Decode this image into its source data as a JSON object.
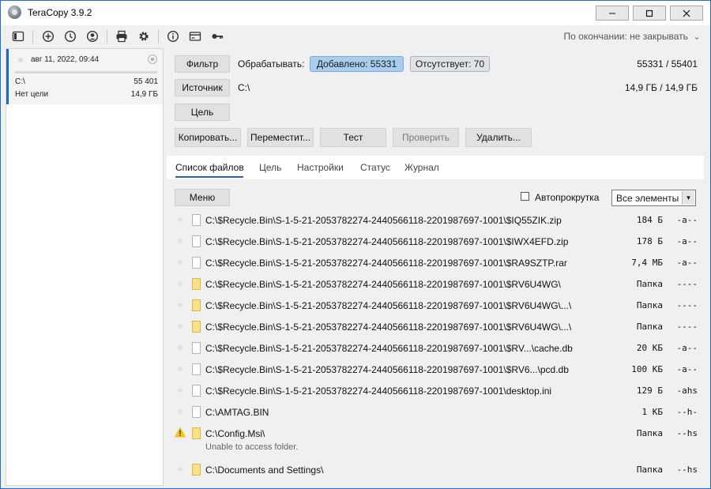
{
  "window": {
    "title": "TeraCopy 3.9.2"
  },
  "toolbar": {
    "on_finish": "По окончании: не закрывать"
  },
  "job": {
    "date": "авг 11, 2022, 09:44",
    "source": "C:\\",
    "count": "55 401",
    "target": "Нет цели",
    "size": "14,9 ГБ",
    "progress": 0
  },
  "panel": {
    "filter_button": "Фильтр",
    "process_label": "Обрабатывать:",
    "added_badge": "Добавлено: 55331",
    "missing_badge": "Отсутствует: 70",
    "file_counts": "55331 / 55401",
    "source_button": "Источник",
    "source_path": "C:\\",
    "size_info": "14,9 ГБ / 14,9 ГБ",
    "target_button": "Цель"
  },
  "actions": {
    "copy": "Копировать...",
    "move": "Переместит...",
    "test": "Тест",
    "verify": "Проверить",
    "delete": "Удалить..."
  },
  "tabs": [
    "Список файлов",
    "Цель",
    "Настройки",
    "Статус",
    "Журнал"
  ],
  "list": {
    "menu_button": "Меню",
    "autoscroll_label": "Автопрокрутка",
    "autoscroll_checked": false,
    "filter_select": "Все элементы",
    "rows": [
      {
        "icon": "file",
        "path": "C:\\$Recycle.Bin\\S-1-5-21-2053782274-2440566118-2201987697-1001\\$IQ55ZIK.zip",
        "size": "184 Б",
        "attr": "-a--"
      },
      {
        "icon": "file",
        "path": "C:\\$Recycle.Bin\\S-1-5-21-2053782274-2440566118-2201987697-1001\\$IWX4EFD.zip",
        "size": "178 Б",
        "attr": "-a--"
      },
      {
        "icon": "file",
        "path": "C:\\$Recycle.Bin\\S-1-5-21-2053782274-2440566118-2201987697-1001\\$RA9SZTP.rar",
        "size": "7,4 МБ",
        "attr": "-a--"
      },
      {
        "icon": "folder",
        "path": "C:\\$Recycle.Bin\\S-1-5-21-2053782274-2440566118-2201987697-1001\\$RV6U4WG\\",
        "size": "Папка",
        "attr": "----"
      },
      {
        "icon": "folder",
        "path": "C:\\$Recycle.Bin\\S-1-5-21-2053782274-2440566118-2201987697-1001\\$RV6U4WG\\...\\",
        "size": "Папка",
        "attr": "----"
      },
      {
        "icon": "folder",
        "path": "C:\\$Recycle.Bin\\S-1-5-21-2053782274-2440566118-2201987697-1001\\$RV6U4WG\\...\\",
        "size": "Папка",
        "attr": "----"
      },
      {
        "icon": "file",
        "path": "C:\\$Recycle.Bin\\S-1-5-21-2053782274-2440566118-2201987697-1001\\$RV...\\cache.db",
        "size": "20 КБ",
        "attr": "-a--"
      },
      {
        "icon": "file",
        "path": "C:\\$Recycle.Bin\\S-1-5-21-2053782274-2440566118-2201987697-1001\\$RV6...\\pcd.db",
        "size": "100 КБ",
        "attr": "-a--"
      },
      {
        "icon": "file",
        "path": "C:\\$Recycle.Bin\\S-1-5-21-2053782274-2440566118-2201987697-1001\\desktop.ini",
        "size": "129 Б",
        "attr": "-ahs"
      },
      {
        "icon": "file",
        "path": "C:\\AMTAG.BIN",
        "size": "1 КБ",
        "attr": "--h-"
      },
      {
        "icon": "folder",
        "path": "C:\\Config.Msi\\",
        "size": "Папка",
        "attr": "--hs",
        "warning": true,
        "error": "Unable to access folder."
      },
      {
        "icon": "folder",
        "path": "C:\\Documents and Settings\\",
        "size": "Папка",
        "attr": "--hs"
      }
    ]
  }
}
